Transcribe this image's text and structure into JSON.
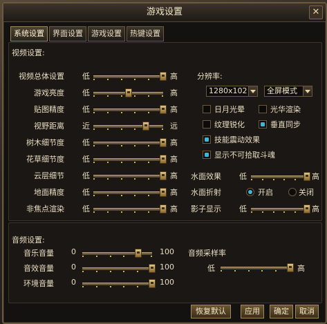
{
  "window": {
    "title": "游戏设置",
    "close_glyph": "✕"
  },
  "tabs": [
    {
      "label": "系统设置",
      "active": true
    },
    {
      "label": "界面设置",
      "active": false
    },
    {
      "label": "游戏设置",
      "active": false
    },
    {
      "label": "热键设置",
      "active": false
    }
  ],
  "video": {
    "section_label": "视频设置:",
    "sliders": [
      {
        "label": "视频总体设置",
        "min_label": "低",
        "max_label": "高",
        "value": 1.0
      },
      {
        "label": "游戏亮度",
        "min_label": "低",
        "max_label": "高",
        "value": 0.5
      },
      {
        "label": "贴图精度",
        "min_label": "低",
        "max_label": "高",
        "value": 1.0
      },
      {
        "label": "视野距离",
        "min_label": "近",
        "max_label": "远",
        "value": 0.75
      },
      {
        "label": "树木细节度",
        "min_label": "低",
        "max_label": "高",
        "value": 1.0
      },
      {
        "label": "花草细节度",
        "min_label": "低",
        "max_label": "高",
        "value": 1.0
      },
      {
        "label": "云层细节",
        "min_label": "低",
        "max_label": "高",
        "value": 1.0
      },
      {
        "label": "地面精度",
        "min_label": "低",
        "max_label": "高",
        "value": 1.0
      },
      {
        "label": "非焦点渲染",
        "min_label": "低",
        "max_label": "高",
        "value": 1.0
      }
    ],
    "resolution": {
      "label": "分辨率:",
      "value": "1280x102",
      "mode": "全屏模式"
    },
    "checkboxes": [
      {
        "label": "日月光晕",
        "checked": false
      },
      {
        "label": "光华渲染",
        "checked": false
      },
      {
        "label": "纹理锐化",
        "checked": false
      },
      {
        "label": "垂直同步",
        "checked": true
      },
      {
        "label": "技能震动效果",
        "checked": true
      },
      {
        "label": "显示不可拾取斗魂",
        "checked": true
      }
    ],
    "water_effect": {
      "label": "水面效果",
      "min_label": "低",
      "max_label": "高",
      "value": 1.0
    },
    "water_refraction": {
      "label": "水面折射",
      "on_label": "开启",
      "off_label": "关闭",
      "selected": "on"
    },
    "shadow": {
      "label": "影子显示",
      "min_label": "低",
      "max_label": "高",
      "value": 1.0
    }
  },
  "audio": {
    "section_label": "音频设置:",
    "sliders": [
      {
        "label": "音乐音量",
        "min_label": "0",
        "max_label": "100",
        "value": 0.8
      },
      {
        "label": "音效音量",
        "min_label": "0",
        "max_label": "100",
        "value": 1.0
      },
      {
        "label": "环境音量",
        "min_label": "0",
        "max_label": "100",
        "value": 1.0
      }
    ],
    "sample_rate": {
      "label": "音频采样率",
      "min_label": "低",
      "max_label": "高",
      "value": 1.0
    }
  },
  "buttons": {
    "restore": "恢复默认",
    "apply": "应用",
    "ok": "确定",
    "cancel": "取消"
  }
}
